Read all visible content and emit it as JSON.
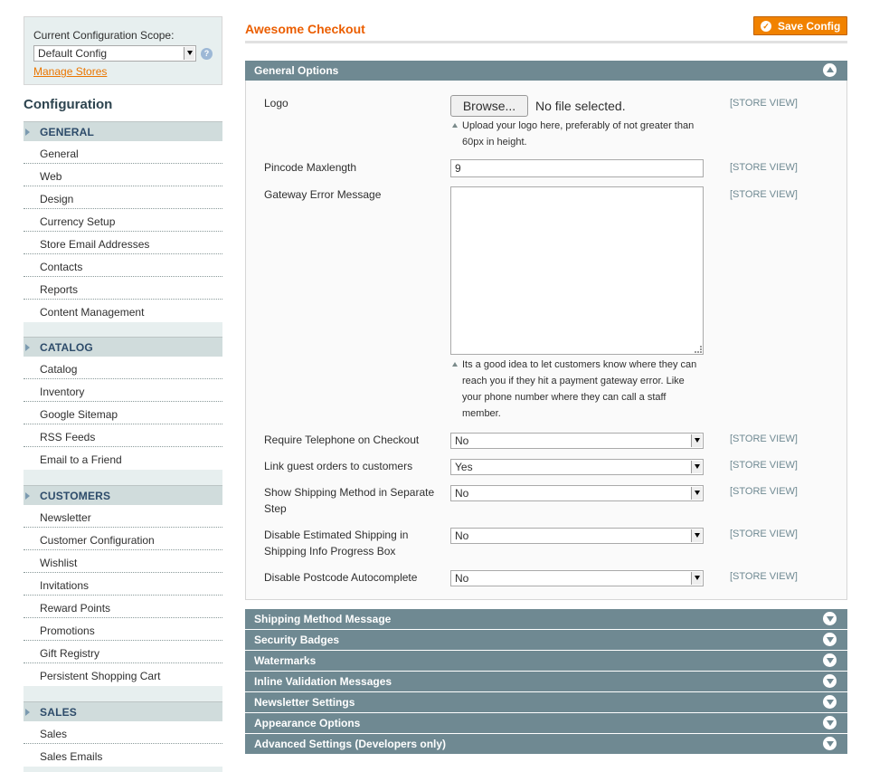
{
  "sidebar": {
    "scope_label": "Current Configuration Scope:",
    "scope_value": "Default Config",
    "manage_stores": "Manage Stores",
    "help": "?",
    "title": "Configuration",
    "groups": [
      {
        "title": "GENERAL",
        "items": [
          "General",
          "Web",
          "Design",
          "Currency Setup",
          "Store Email Addresses",
          "Contacts",
          "Reports",
          "Content Management"
        ]
      },
      {
        "title": "CATALOG",
        "items": [
          "Catalog",
          "Inventory",
          "Google Sitemap",
          "RSS Feeds",
          "Email to a Friend"
        ]
      },
      {
        "title": "CUSTOMERS",
        "items": [
          "Newsletter",
          "Customer Configuration",
          "Wishlist",
          "Invitations",
          "Reward Points",
          "Promotions",
          "Gift Registry",
          "Persistent Shopping Cart"
        ]
      },
      {
        "title": "SALES",
        "items": [
          "Sales",
          "Sales Emails"
        ]
      }
    ]
  },
  "main": {
    "title": "Awesome Checkout",
    "save_label": "Save Config",
    "general_section": "General Options",
    "fields": {
      "logo_label": "Logo",
      "browse_label": "Browse...",
      "no_file": "No file selected.",
      "logo_note": "Upload your logo here, preferably of not greater than 60px in height.",
      "pincode_label": "Pincode Maxlength",
      "pincode_value": "9",
      "gateway_label": "Gateway Error Message",
      "gateway_note": "Its a good idea to let customers know where they can reach you if they hit a payment gateway error. Like your phone number where they can call a staff member.",
      "telephone_label": "Require Telephone on Checkout",
      "telephone_value": "No",
      "guest_label": "Link guest orders to customers",
      "guest_value": "Yes",
      "shipmethod_label": "Show Shipping Method in Separate Step",
      "shipmethod_value": "No",
      "estship_label": "Disable Estimated Shipping in Shipping Info Progress Box",
      "estship_value": "No",
      "postcode_label": "Disable Postcode Autocomplete",
      "postcode_value": "No",
      "scope": "[STORE VIEW]"
    },
    "collapsed_sections": [
      "Shipping Method Message",
      "Security Badges",
      "Watermarks",
      "Inline Validation Messages",
      "Newsletter Settings",
      "Appearance Options",
      "Advanced Settings (Developers only)"
    ]
  }
}
